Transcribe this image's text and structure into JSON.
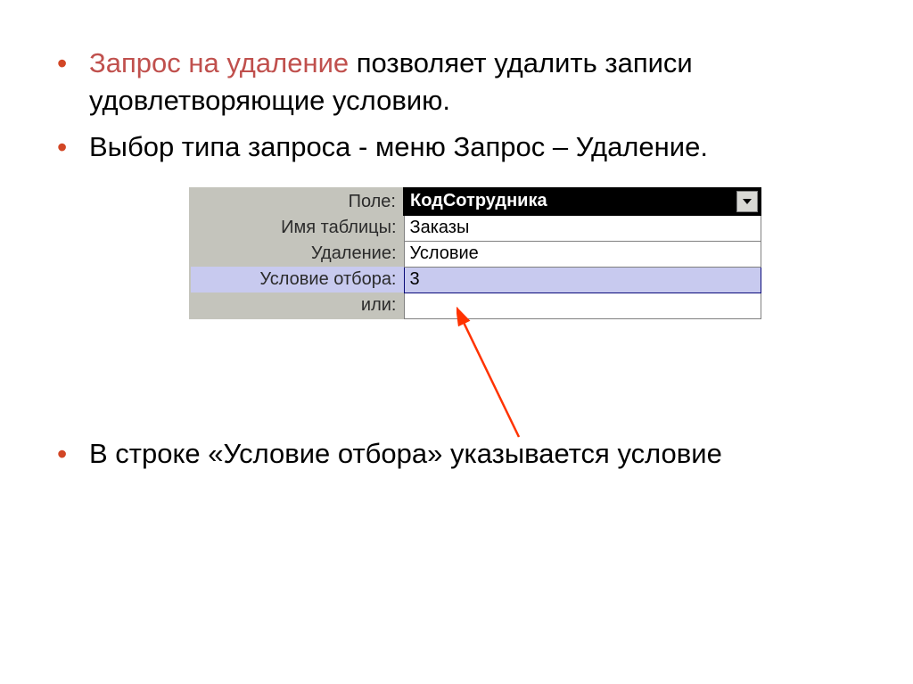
{
  "bullets": {
    "b1_highlight": "Запрос на удаление",
    "b1_rest": " позволяет удалить записи удовлетворяющие условию.",
    "b2": "Выбор типа запроса - меню Запрос – Удаление.",
    "b3": "В строке «Условие отбора» указывается условие"
  },
  "grid": {
    "rows": [
      {
        "label": "Поле:",
        "value": "КодСотрудника",
        "inverted": true,
        "dropdown": true
      },
      {
        "label": "Имя таблицы:",
        "value": "Заказы"
      },
      {
        "label": "Удаление:",
        "value": "Условие"
      },
      {
        "label": "Условие отбора:",
        "value": "3",
        "selected": true
      },
      {
        "label": "или:",
        "value": ""
      }
    ]
  }
}
